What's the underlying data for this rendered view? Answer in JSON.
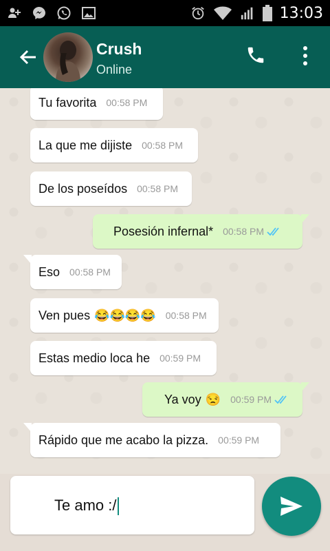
{
  "status_bar": {
    "time": "13:03",
    "icons": [
      "add-contact-icon",
      "messenger-icon",
      "whatsapp-icon",
      "image-icon",
      "alarm-icon",
      "wifi-icon",
      "signal-icon",
      "battery-icon"
    ]
  },
  "header": {
    "contact_name": "Crush",
    "contact_status": "Online",
    "color": "#075e54"
  },
  "messages": [
    {
      "direction": "in",
      "text": "Tu favorita",
      "time": "00:58 PM"
    },
    {
      "direction": "in",
      "text": "La que me dijiste",
      "time": "00:58 PM"
    },
    {
      "direction": "in",
      "text": "De los poseídos",
      "time": "00:58 PM"
    },
    {
      "direction": "out",
      "text": "Posesión infernal*",
      "time": "00:58 PM",
      "read": true
    },
    {
      "direction": "in",
      "text": "Eso",
      "time": "00:58 PM"
    },
    {
      "direction": "in",
      "text": "Ven pues",
      "emoji": "😂😂😂😂",
      "time": "00:58 PM"
    },
    {
      "direction": "in",
      "text": "Estas medio loca he",
      "time": "00:59 PM"
    },
    {
      "direction": "out",
      "text": "Ya voy",
      "emoji": "😒",
      "time": "00:59 PM",
      "read": true
    },
    {
      "direction": "in",
      "text": "Rápido que me acabo la pizza.",
      "time": "00:59 PM"
    }
  ],
  "composer": {
    "value": "Te amo :/"
  },
  "colors": {
    "outgoing_bubble": "#dcf8c6",
    "incoming_bubble": "#ffffff",
    "send_button": "#128c7e",
    "read_ticks": "#4fc3f7"
  }
}
